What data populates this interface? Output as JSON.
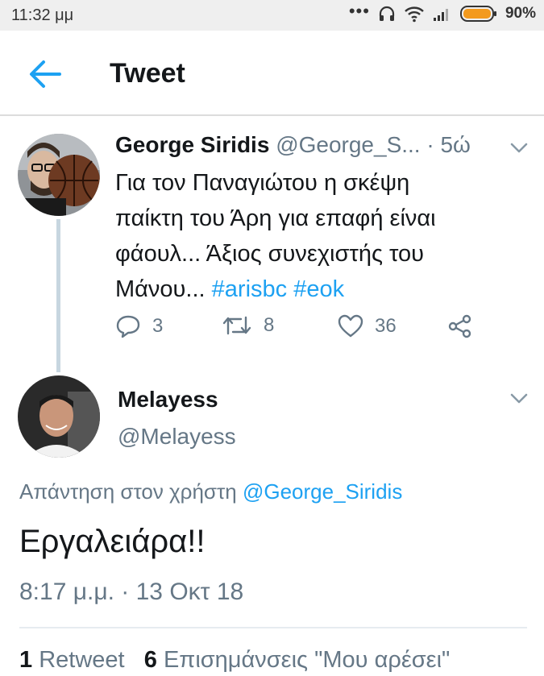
{
  "status_bar": {
    "time": "11:32 μμ",
    "battery": "90%"
  },
  "header": {
    "title": "Tweet"
  },
  "parent_tweet": {
    "name": "George Siridis",
    "handle": "@George_S...",
    "time": "· 5ώ",
    "text_line1": "Για τον Παναγιώτου η σκέψη",
    "text_line2": "παίκτη του Άρη για επαφή είναι",
    "text_line3": "φάουλ... Άξιος συνεχιστής του",
    "text_line4": "Μάνου...",
    "hashtag1": "#arisbc",
    "hashtag2": "#eok",
    "replies": "3",
    "retweets": "8",
    "likes": "36"
  },
  "main_tweet": {
    "name": "Melayess",
    "handle": "@Melayess",
    "reply_prefix": "Απάντηση στον χρήστη",
    "reply_to": "@George_Siridis",
    "text": "Εργαλειάρα!!",
    "datetime": "8:17 μ.μ. · 13 Οκτ 18",
    "retweet_count": "1",
    "retweet_label": "Retweet",
    "like_count": "6",
    "like_label": "Επισημάνσεις \"Μου αρέσει\""
  }
}
